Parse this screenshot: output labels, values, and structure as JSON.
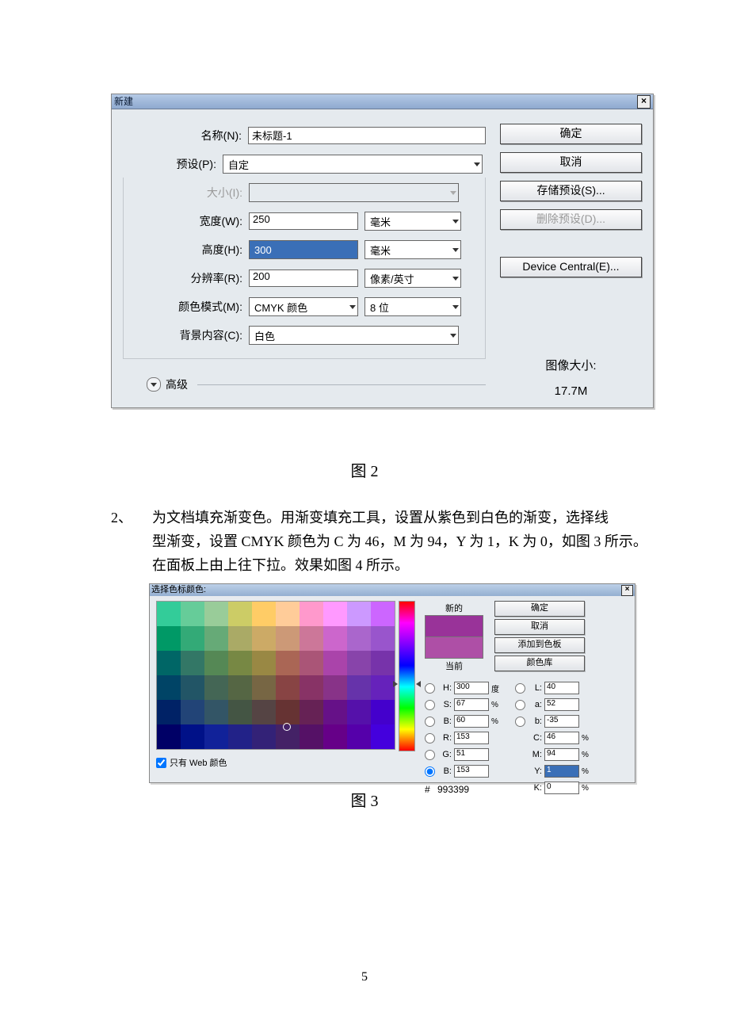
{
  "page_number": "5",
  "captions": {
    "fig2": "图 2",
    "fig3": "图 3"
  },
  "body_text": {
    "num": "2、",
    "line1": "为文档填充渐变色。用渐变填充工具，设置从紫色到白色的渐变，选择线",
    "line2": "型渐变，设置 CMYK 颜色为 C 为 46，M 为 94，Y 为 1，K 为 0，如图 3 所示。",
    "line3": "在面板上由上往下拉。效果如图 4 所示。"
  },
  "dlg1": {
    "title": "新建",
    "labels": {
      "name": "名称(N):",
      "preset": "预设(P):",
      "size": "大小(I):",
      "width": "宽度(W):",
      "height": "高度(H):",
      "res": "分辨率(R):",
      "mode": "颜色模式(M):",
      "bg": "背景内容(C):",
      "adv": "高级",
      "imgsize": "图像大小:"
    },
    "values": {
      "name": "未标题-1",
      "preset": "自定",
      "size": "",
      "width": "250",
      "height": "300",
      "res": "200",
      "mode": "CMYK 颜色",
      "bits": "8 位",
      "bg": "白色",
      "width_unit": "毫米",
      "height_unit": "毫米",
      "res_unit": "像素/英寸",
      "imgsize": "17.7M"
    },
    "buttons": {
      "ok": "确定",
      "cancel": "取消",
      "save": "存储预设(S)...",
      "del": "删除预设(D)...",
      "dc": "Device Central(E)..."
    }
  },
  "dlg2": {
    "title": "选择色标颜色:",
    "labels": {
      "new": "新的",
      "cur": "当前",
      "webonly": "只有 Web 颜色"
    },
    "buttons": {
      "ok": "确定",
      "cancel": "取消",
      "add": "添加到色板",
      "lib": "颜色库"
    },
    "fields": {
      "H": {
        "v": "300",
        "u": "度"
      },
      "S": {
        "v": "67",
        "u": "%"
      },
      "Bhsb": {
        "v": "60",
        "u": "%"
      },
      "R": {
        "v": "153"
      },
      "G": {
        "v": "51"
      },
      "Brgb": {
        "v": "153"
      },
      "L": {
        "v": "40"
      },
      "a": {
        "v": "52"
      },
      "b": {
        "v": "-35"
      },
      "C": {
        "v": "46",
        "u": "%"
      },
      "M": {
        "v": "94",
        "u": "%"
      },
      "Y": {
        "v": "1",
        "u": "%"
      },
      "K": {
        "v": "0",
        "u": "%"
      },
      "hex": "993399"
    }
  },
  "palette_colors": [
    [
      "#33cc99",
      "#66cc99",
      "#99cc99",
      "#cccc66",
      "#ffcc66",
      "#ffcc99",
      "#ff99cc",
      "#ff99ff",
      "#cc99ff",
      "#cc66ff"
    ],
    [
      "#009966",
      "#33aa77",
      "#66aa77",
      "#aaaa66",
      "#ccaa66",
      "#cc9977",
      "#cc7799",
      "#cc66cc",
      "#aa66cc",
      "#9955cc"
    ],
    [
      "#006666",
      "#337766",
      "#558855",
      "#778844",
      "#998844",
      "#aa6655",
      "#aa5577",
      "#aa44aa",
      "#8844aa",
      "#7733aa"
    ],
    [
      "#004466",
      "#225566",
      "#446655",
      "#556644",
      "#776644",
      "#884444",
      "#883366",
      "#883388",
      "#6633aa",
      "#6622bb"
    ],
    [
      "#002266",
      "#224477",
      "#335566",
      "#445544",
      "#554444",
      "#663333",
      "#662255",
      "#661188",
      "#5511aa",
      "#4400cc"
    ],
    [
      "#000066",
      "#001188",
      "#112299",
      "#222288",
      "#332277",
      "#442266",
      "#551166",
      "#660088",
      "#5500aa",
      "#4400dd"
    ]
  ]
}
